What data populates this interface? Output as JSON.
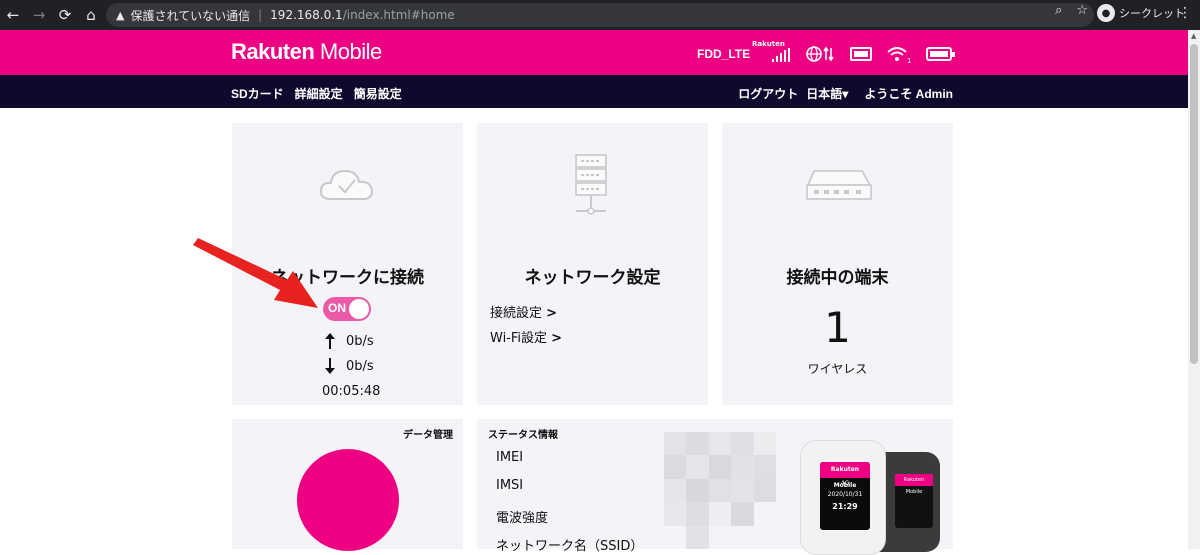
{
  "browser": {
    "insecure_label": "保護されていない通信",
    "url_host": "192.168.0.1",
    "url_path": "/index.html#home",
    "incognito_label": "シークレット"
  },
  "header": {
    "logo_brand": "Rakuten",
    "logo_product": " Mobile",
    "network_type": "FDD_LTE",
    "signal_operator": "Rakuten",
    "wifi_clients_badge": "1",
    "accent_color": "#ee0082",
    "nav_color": "#0d0a2e"
  },
  "nav": {
    "left": [
      "SDカード",
      "詳細設定",
      "簡易設定"
    ],
    "logout": "ログアウト",
    "language": "日本語▾",
    "welcome": "ようこそ Admin"
  },
  "cards": {
    "connection": {
      "title": "ネットワークに接続",
      "toggle_label": "ON",
      "upload_rate": "0b/s",
      "download_rate": "0b/s",
      "duration": "00:05:48"
    },
    "network_settings": {
      "title": "ネットワーク設定",
      "links": [
        "接続設定",
        "Wi-Fi設定"
      ]
    },
    "devices": {
      "title": "接続中の端末",
      "count": "1",
      "type_label": "ワイヤレス"
    },
    "data": {
      "title": "データ管理"
    },
    "status": {
      "title": "ステータス情報",
      "labels": [
        "IMEI",
        "IMSI",
        "電波強度",
        "ネットワーク名（SSID）"
      ],
      "device_screen": {
        "brand": "Rakuten Mobile",
        "network": "4G",
        "date": "2020/10/31",
        "time": "21:29"
      }
    }
  },
  "icons": {
    "back": "←",
    "forward": "→",
    "reload": "⟳",
    "home": "⌂",
    "warning": "▲",
    "zoom": "⌕",
    "star": "☆",
    "kebab": "⋮",
    "globe": "⊕⇅",
    "wifi": "≈",
    "up_arrow": "🡅",
    "down_arrow": "🡇",
    "chevron": "›"
  }
}
